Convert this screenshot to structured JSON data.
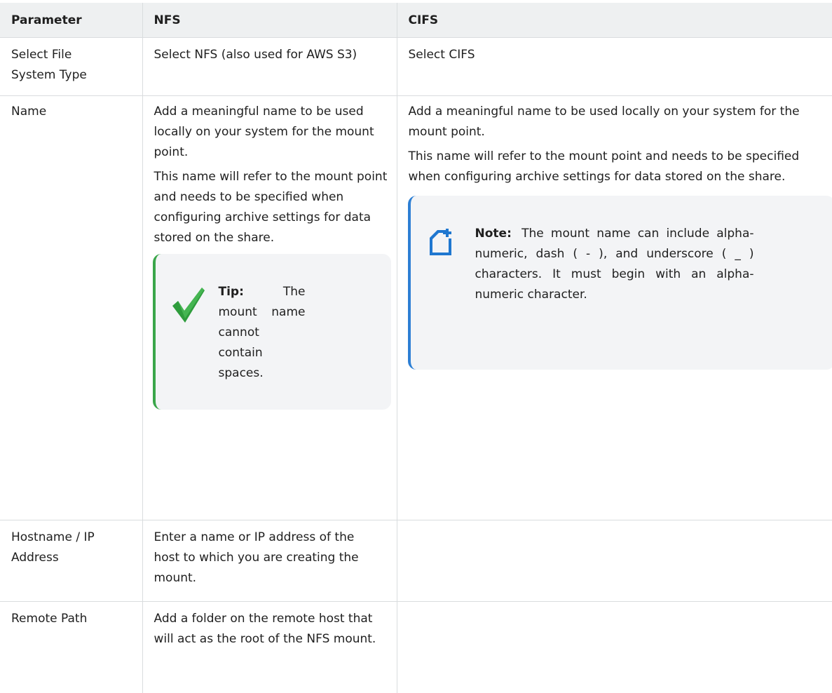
{
  "table": {
    "headers": [
      "Parameter",
      "NFS",
      "CIFS"
    ],
    "rows": {
      "file_type": {
        "param": "Select File System Type",
        "nfs": "Select NFS (also used for AWS S3)",
        "cifs": "Select CIFS"
      },
      "name": {
        "param": "Name",
        "nfs_p1": "Add a meaningful name to be used locally on your system for the mount point.",
        "nfs_p2": "This name will refer to the mount point and needs to be specified when configuring archive settings for data stored on the share.",
        "tip_label": "Tip:",
        "tip_text": "The mount name cannot contain spaces.",
        "cifs_p1": "Add a meaningful name to be used locally on your system for the mount point.",
        "cifs_p2": "This name will refer to the mount point and needs to be specified when configuring archive settings for data stored on the share.",
        "note_label": "Note:",
        "note_text": "The mount name can include alpha- numeric, dash ( - ), and underscore ( _ ) characters. It must begin with an alpha- numeric character."
      },
      "hostname": {
        "param": "Hostname / IP Address",
        "nfs": "Enter a name or IP address of the host to which you are creating the mount.",
        "cifs": ""
      },
      "remote_path": {
        "param": "Remote Path",
        "nfs": "Add a folder on the remote host that will act as the root of the NFS mount.",
        "cifs": ""
      }
    }
  },
  "icons": {
    "tip": "checkmark-icon",
    "note": "note-icon"
  },
  "colors": {
    "header_bg": "#eef0f1",
    "tip_accent": "#3aa64a",
    "note_accent": "#2d7fd4",
    "callout_bg": "#f3f4f6",
    "border": "#d9dcde"
  }
}
